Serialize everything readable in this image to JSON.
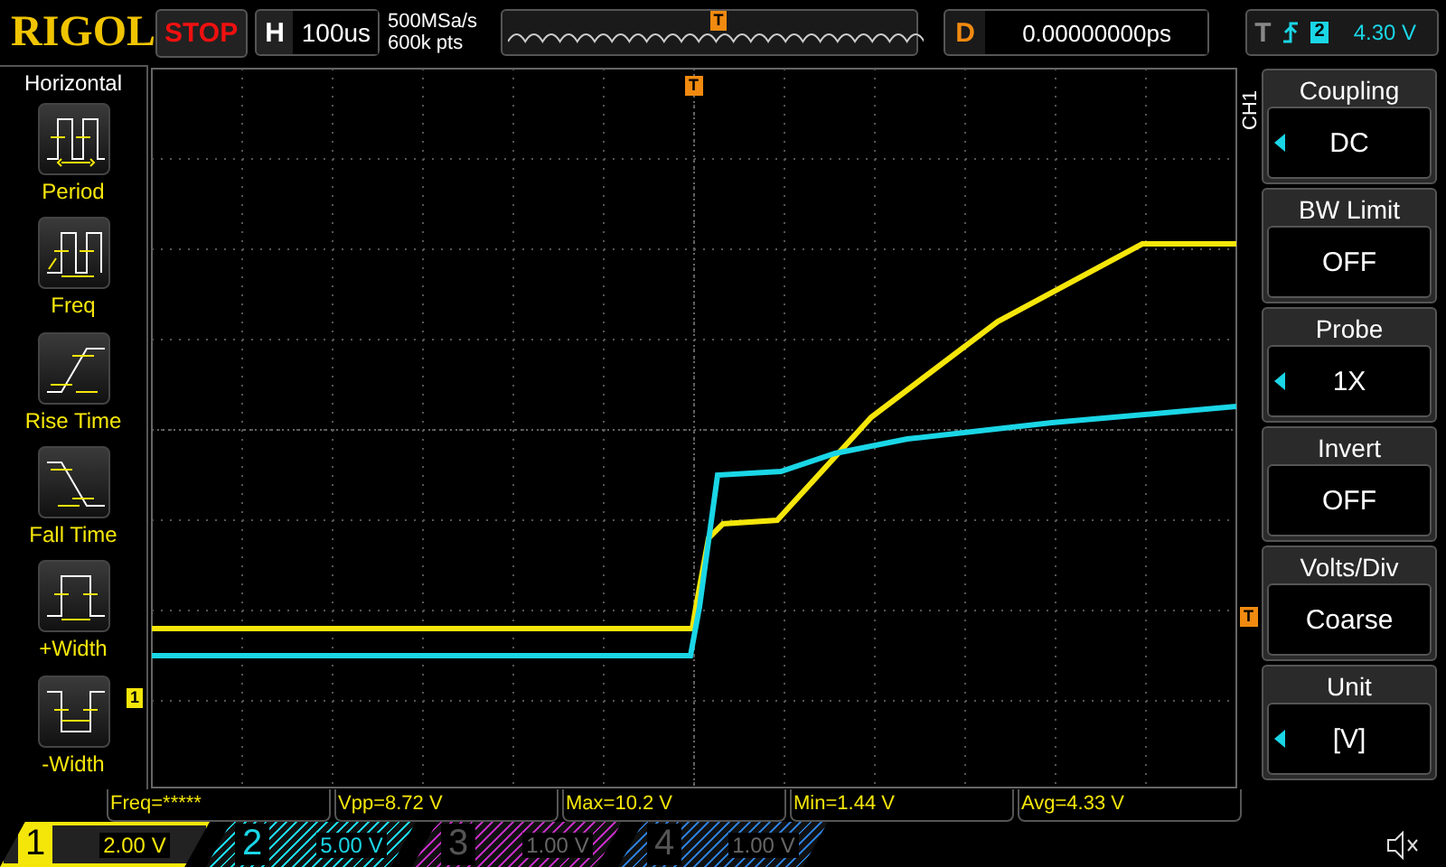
{
  "top_bar": {
    "brand": "RIGOL",
    "run_state": "STOP",
    "horizontal": {
      "label": "H",
      "timebase": "100us"
    },
    "sample_rate": "500MSa/s",
    "memory_depth": "600k pts",
    "memory_marker": "T",
    "delay": {
      "label": "D",
      "value": "0.00000000ps"
    },
    "trigger": {
      "label": "T",
      "source": "2",
      "level": "4.30 V"
    }
  },
  "left_menu": {
    "title": "Horizontal",
    "items": [
      {
        "label": "Period",
        "kind": "period"
      },
      {
        "label": "Freq",
        "kind": "freq"
      },
      {
        "label": "Rise Time",
        "kind": "rise"
      },
      {
        "label": "Fall Time",
        "kind": "fall"
      },
      {
        "label": "+Width",
        "kind": "pwidth"
      },
      {
        "label": "-Width",
        "kind": "nwidth"
      }
    ]
  },
  "screen": {
    "trigger_position_marker": "T",
    "trigger_level_marker": "T",
    "channel_marker": "1"
  },
  "right_menu": {
    "channel": "CH1",
    "items": [
      {
        "label": "Coupling",
        "value": "DC",
        "adjustable": true
      },
      {
        "label": "BW Limit",
        "value": "OFF",
        "adjustable": false
      },
      {
        "label": "Probe",
        "value": "1X",
        "adjustable": true
      },
      {
        "label": "Invert",
        "value": "OFF",
        "adjustable": false
      },
      {
        "label": "Volts/Div",
        "value": "Coarse",
        "adjustable": false
      },
      {
        "label": "Unit",
        "value": "[V]",
        "adjustable": true
      }
    ]
  },
  "measurements": [
    "Freq=*****",
    "Vpp=8.72 V",
    "Max=10.2 V",
    "Min=1.44 V",
    "Avg=4.33 V"
  ],
  "channels": [
    {
      "number": "1",
      "scale": "2.00 V",
      "color": "#f5e60a",
      "on": true,
      "selected": true
    },
    {
      "number": "2",
      "scale": "5.00 V",
      "color": "#1ad6e6",
      "on": true,
      "selected": false
    },
    {
      "number": "3",
      "scale": "1.00 V",
      "color": "#c02cc0",
      "on": false,
      "selected": false
    },
    {
      "number": "4",
      "scale": "1.00 V",
      "color": "#2a7ad0",
      "on": false,
      "selected": false
    }
  ]
}
